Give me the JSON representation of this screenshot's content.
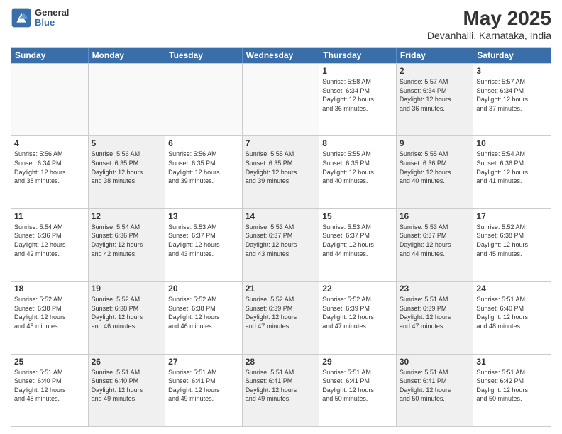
{
  "logo": {
    "general": "General",
    "blue": "Blue"
  },
  "title": "May 2025",
  "subtitle": "Devanhalli, Karnataka, India",
  "headers": [
    "Sunday",
    "Monday",
    "Tuesday",
    "Wednesday",
    "Thursday",
    "Friday",
    "Saturday"
  ],
  "weeks": [
    [
      {
        "day": "",
        "text": "",
        "empty": true
      },
      {
        "day": "",
        "text": "",
        "empty": true
      },
      {
        "day": "",
        "text": "",
        "empty": true
      },
      {
        "day": "",
        "text": "",
        "empty": true
      },
      {
        "day": "1",
        "text": "Sunrise: 5:58 AM\nSunset: 6:34 PM\nDaylight: 12 hours\nand 36 minutes.",
        "shaded": false
      },
      {
        "day": "2",
        "text": "Sunrise: 5:57 AM\nSunset: 6:34 PM\nDaylight: 12 hours\nand 36 minutes.",
        "shaded": true
      },
      {
        "day": "3",
        "text": "Sunrise: 5:57 AM\nSunset: 6:34 PM\nDaylight: 12 hours\nand 37 minutes.",
        "shaded": false
      }
    ],
    [
      {
        "day": "4",
        "text": "Sunrise: 5:56 AM\nSunset: 6:34 PM\nDaylight: 12 hours\nand 38 minutes.",
        "shaded": false
      },
      {
        "day": "5",
        "text": "Sunrise: 5:56 AM\nSunset: 6:35 PM\nDaylight: 12 hours\nand 38 minutes.",
        "shaded": true
      },
      {
        "day": "6",
        "text": "Sunrise: 5:56 AM\nSunset: 6:35 PM\nDaylight: 12 hours\nand 39 minutes.",
        "shaded": false
      },
      {
        "day": "7",
        "text": "Sunrise: 5:55 AM\nSunset: 6:35 PM\nDaylight: 12 hours\nand 39 minutes.",
        "shaded": true
      },
      {
        "day": "8",
        "text": "Sunrise: 5:55 AM\nSunset: 6:35 PM\nDaylight: 12 hours\nand 40 minutes.",
        "shaded": false
      },
      {
        "day": "9",
        "text": "Sunrise: 5:55 AM\nSunset: 6:36 PM\nDaylight: 12 hours\nand 40 minutes.",
        "shaded": true
      },
      {
        "day": "10",
        "text": "Sunrise: 5:54 AM\nSunset: 6:36 PM\nDaylight: 12 hours\nand 41 minutes.",
        "shaded": false
      }
    ],
    [
      {
        "day": "11",
        "text": "Sunrise: 5:54 AM\nSunset: 6:36 PM\nDaylight: 12 hours\nand 42 minutes.",
        "shaded": false
      },
      {
        "day": "12",
        "text": "Sunrise: 5:54 AM\nSunset: 6:36 PM\nDaylight: 12 hours\nand 42 minutes.",
        "shaded": true
      },
      {
        "day": "13",
        "text": "Sunrise: 5:53 AM\nSunset: 6:37 PM\nDaylight: 12 hours\nand 43 minutes.",
        "shaded": false
      },
      {
        "day": "14",
        "text": "Sunrise: 5:53 AM\nSunset: 6:37 PM\nDaylight: 12 hours\nand 43 minutes.",
        "shaded": true
      },
      {
        "day": "15",
        "text": "Sunrise: 5:53 AM\nSunset: 6:37 PM\nDaylight: 12 hours\nand 44 minutes.",
        "shaded": false
      },
      {
        "day": "16",
        "text": "Sunrise: 5:53 AM\nSunset: 6:37 PM\nDaylight: 12 hours\nand 44 minutes.",
        "shaded": true
      },
      {
        "day": "17",
        "text": "Sunrise: 5:52 AM\nSunset: 6:38 PM\nDaylight: 12 hours\nand 45 minutes.",
        "shaded": false
      }
    ],
    [
      {
        "day": "18",
        "text": "Sunrise: 5:52 AM\nSunset: 6:38 PM\nDaylight: 12 hours\nand 45 minutes.",
        "shaded": false
      },
      {
        "day": "19",
        "text": "Sunrise: 5:52 AM\nSunset: 6:38 PM\nDaylight: 12 hours\nand 46 minutes.",
        "shaded": true
      },
      {
        "day": "20",
        "text": "Sunrise: 5:52 AM\nSunset: 6:38 PM\nDaylight: 12 hours\nand 46 minutes.",
        "shaded": false
      },
      {
        "day": "21",
        "text": "Sunrise: 5:52 AM\nSunset: 6:39 PM\nDaylight: 12 hours\nand 47 minutes.",
        "shaded": true
      },
      {
        "day": "22",
        "text": "Sunrise: 5:52 AM\nSunset: 6:39 PM\nDaylight: 12 hours\nand 47 minutes.",
        "shaded": false
      },
      {
        "day": "23",
        "text": "Sunrise: 5:51 AM\nSunset: 6:39 PM\nDaylight: 12 hours\nand 47 minutes.",
        "shaded": true
      },
      {
        "day": "24",
        "text": "Sunrise: 5:51 AM\nSunset: 6:40 PM\nDaylight: 12 hours\nand 48 minutes.",
        "shaded": false
      }
    ],
    [
      {
        "day": "25",
        "text": "Sunrise: 5:51 AM\nSunset: 6:40 PM\nDaylight: 12 hours\nand 48 minutes.",
        "shaded": false
      },
      {
        "day": "26",
        "text": "Sunrise: 5:51 AM\nSunset: 6:40 PM\nDaylight: 12 hours\nand 49 minutes.",
        "shaded": true
      },
      {
        "day": "27",
        "text": "Sunrise: 5:51 AM\nSunset: 6:41 PM\nDaylight: 12 hours\nand 49 minutes.",
        "shaded": false
      },
      {
        "day": "28",
        "text": "Sunrise: 5:51 AM\nSunset: 6:41 PM\nDaylight: 12 hours\nand 49 minutes.",
        "shaded": true
      },
      {
        "day": "29",
        "text": "Sunrise: 5:51 AM\nSunset: 6:41 PM\nDaylight: 12 hours\nand 50 minutes.",
        "shaded": false
      },
      {
        "day": "30",
        "text": "Sunrise: 5:51 AM\nSunset: 6:41 PM\nDaylight: 12 hours\nand 50 minutes.",
        "shaded": true
      },
      {
        "day": "31",
        "text": "Sunrise: 5:51 AM\nSunset: 6:42 PM\nDaylight: 12 hours\nand 50 minutes.",
        "shaded": false
      }
    ]
  ]
}
